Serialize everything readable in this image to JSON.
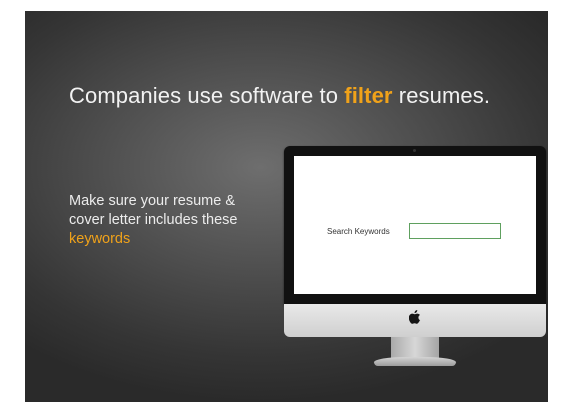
{
  "headline": {
    "before": "Companies use software to ",
    "accent": "filter",
    "after": " resumes."
  },
  "body": {
    "line1": "Make sure your resume &",
    "line2": "cover letter includes these",
    "keyword": "keywords"
  },
  "monitor": {
    "search_label": "Search Keywords",
    "search_value": "",
    "logo_icon": "apple-logo-icon"
  },
  "colors": {
    "accent": "#f0a21a",
    "input_border": "#5fa05f",
    "background_center": "#6e6e6e",
    "background_edge": "#2a2a2a"
  }
}
